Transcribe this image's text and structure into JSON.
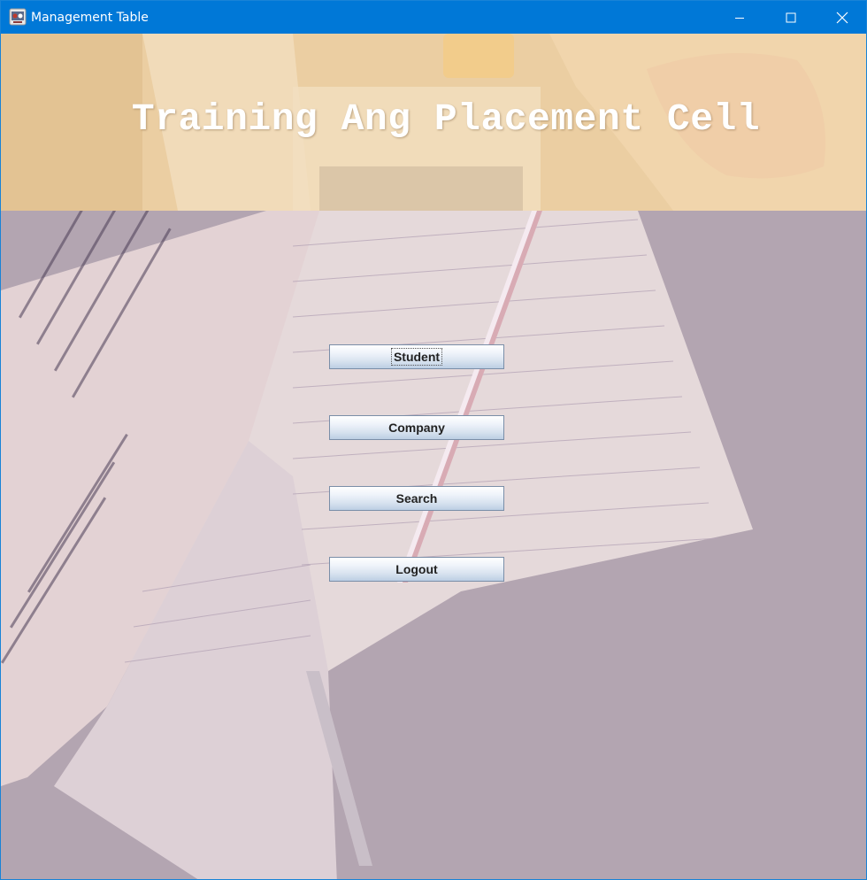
{
  "window": {
    "title": "Management Table",
    "icon": "java-app-icon",
    "controls": [
      "minimize-icon",
      "maximize-icon",
      "close-icon"
    ]
  },
  "banner": {
    "title": "Training Ang Placement Cell"
  },
  "menu": {
    "student_label": "Student",
    "company_label": "Company",
    "search_label": "Search",
    "logout_label": "Logout",
    "focused": "Student"
  },
  "colors": {
    "titlebar": "#0078d7",
    "banner_tint": "#e7c79a",
    "button_bottom": "#bccee3"
  }
}
